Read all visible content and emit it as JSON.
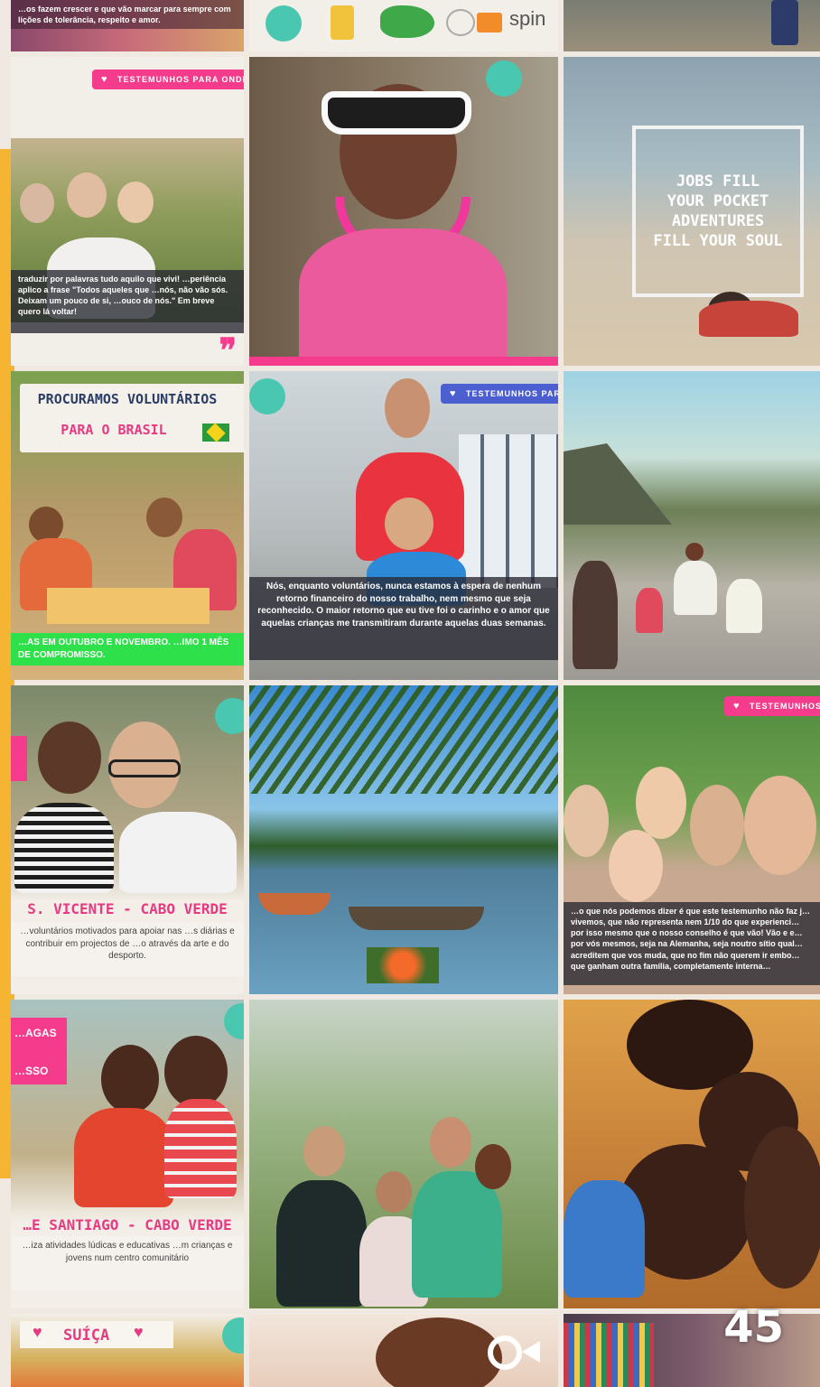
{
  "row0": {
    "left_text": "…os fazem crescer e que vão marcar para sempre com lições de tolerância, respeito e amor.",
    "logo_spin": "spin"
  },
  "tile_testimony_1": {
    "pill": "TESTEMUNHOS PARA ONDE",
    "quote": "traduzir por palavras tudo aquilo que vivi! …periência aplico a frase \"Todos aqueles que …nós, não vão sós. Deixam um pouco de si, …ouco de nós.\" Em breve quero lá voltar!"
  },
  "tile_jobs": {
    "line1": "JOBS FILL",
    "line2": "YOUR POCKET",
    "line3": "ADVENTURES",
    "line4": "FILL YOUR SOUL"
  },
  "tile_brasil": {
    "title": "PROCURAMOS VOLUNTÁRIOS",
    "subtitle": "PARA O BRASIL",
    "bottom": "…AS EM OUTUBRO E NOVEMBRO. …IMO 1 MÊS DE COMPROMISSO."
  },
  "tile_testimony_2": {
    "pill": "TESTEMUNHOS PARA ONDE",
    "quote": "Nós, enquanto voluntários, nunca estamos à espera de nenhum retorno financeiro do nosso trabalho, nem mesmo que seja reconhecido. O maior retorno que eu tive foi o carinho e o amor que aquelas crianças me transmitiram durante aquelas duas semanas."
  },
  "tile_cv1": {
    "title": "S. VICENTE - CABO VERDE",
    "desc": "…voluntários motivados para apoiar nas …s diárias e contribuir em projectos de …o através da arte e do desporto."
  },
  "tile_testimony_3": {
    "pill": "TESTEMUNHOS",
    "quote": "…o que nós podemos dizer é que este testemunho não faz j… vivemos, que não representa nem 1/10 do que experienci… por isso mesmo que o nosso conselho é que vão! Vão e e… por vós mesmos, seja na Alemanha, seja noutro sítio qual… acreditem que vos muda, que no fim não querem ir embo… que ganham outra família, completamente interna…"
  },
  "tile_cv2": {
    "tag_top": "…AGAS",
    "tag_bottom": "…SSO",
    "title": "…E SANTIAGO - CABO VERDE",
    "desc": "…iza atividades lúdicas e educativas …m crianças e jovens num centro comunitário"
  },
  "tile_suica": {
    "title": "SUÍÇA"
  },
  "page_number": "45",
  "colors": {
    "accent": "#f6b433",
    "pink": "#f53b8c",
    "blue": "#4c5fd0",
    "teal": "#49c7b0",
    "green": "#2ee04a"
  }
}
